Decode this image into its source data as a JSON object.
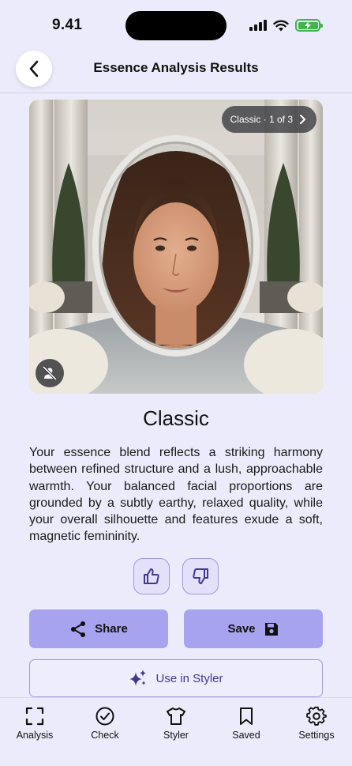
{
  "status": {
    "time": "9.41"
  },
  "header": {
    "title": "Essence Analysis Results"
  },
  "hero": {
    "carousel_label": "Classic · 1 of 3"
  },
  "result": {
    "title": "Classic",
    "description": "Your essence blend reflects a striking harmony between refined structure and a lush, approachable warmth. Your balanced facial proportions are grounded by a subtly earthy, relaxed quality, while your overall silhouette and features exude a soft, magnetic femininity."
  },
  "actions": {
    "share_label": "Share",
    "save_label": "Save",
    "styler_label": "Use in Styler"
  },
  "tabs": [
    {
      "label": "Analysis",
      "icon": "scan-frame-icon"
    },
    {
      "label": "Check",
      "icon": "check-circle-icon"
    },
    {
      "label": "Styler",
      "icon": "tshirt-icon"
    },
    {
      "label": "Saved",
      "icon": "bookmark-icon"
    },
    {
      "label": "Settings",
      "icon": "gear-icon"
    }
  ],
  "colors": {
    "background": "#ECEBFB",
    "accent": "#A7A3EE",
    "accent_border": "#9E9AD9",
    "accent_text": "#3F3A8C",
    "battery": "#3FB54B"
  }
}
